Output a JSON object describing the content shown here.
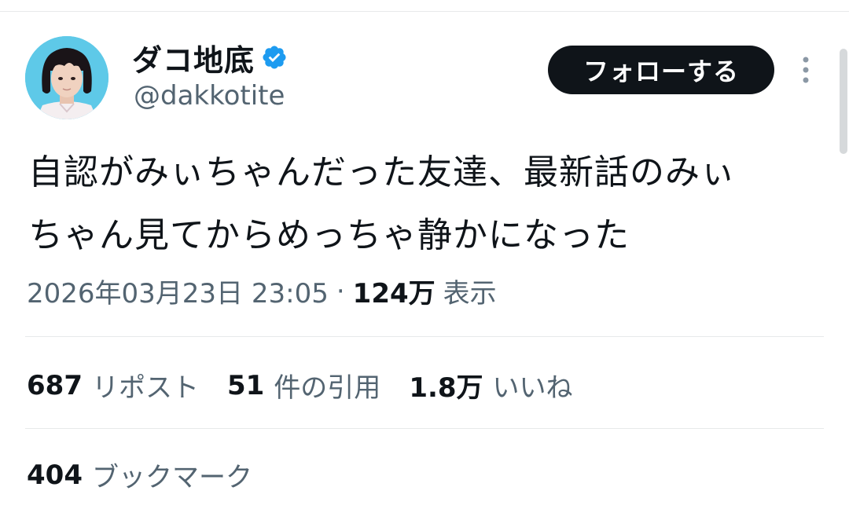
{
  "author": {
    "display_name": "ダコ地底",
    "handle": "@dakkotite",
    "verified": true,
    "verified_color": "#1d9bf0",
    "avatar_bg": "#5ec9e8"
  },
  "follow_button": {
    "label": "フォローする"
  },
  "more_icon": "more-vertical-icon",
  "tweet": {
    "text_line1": "自認がみぃちゃんだった友達、最新話のみぃ",
    "text_line2": "ちゃん見てからめっちゃ静かになった",
    "timestamp": "2026年03月23日 23:05",
    "separator": "·",
    "views_count": "124万",
    "views_label": "表示"
  },
  "stats": {
    "reposts_count": "687",
    "reposts_label": "リポスト",
    "quotes_count": "51",
    "quotes_label": "件の引用",
    "likes_count": "1.8万",
    "likes_label": "いいね",
    "bookmarks_count": "404",
    "bookmarks_label": "ブックマーク"
  }
}
